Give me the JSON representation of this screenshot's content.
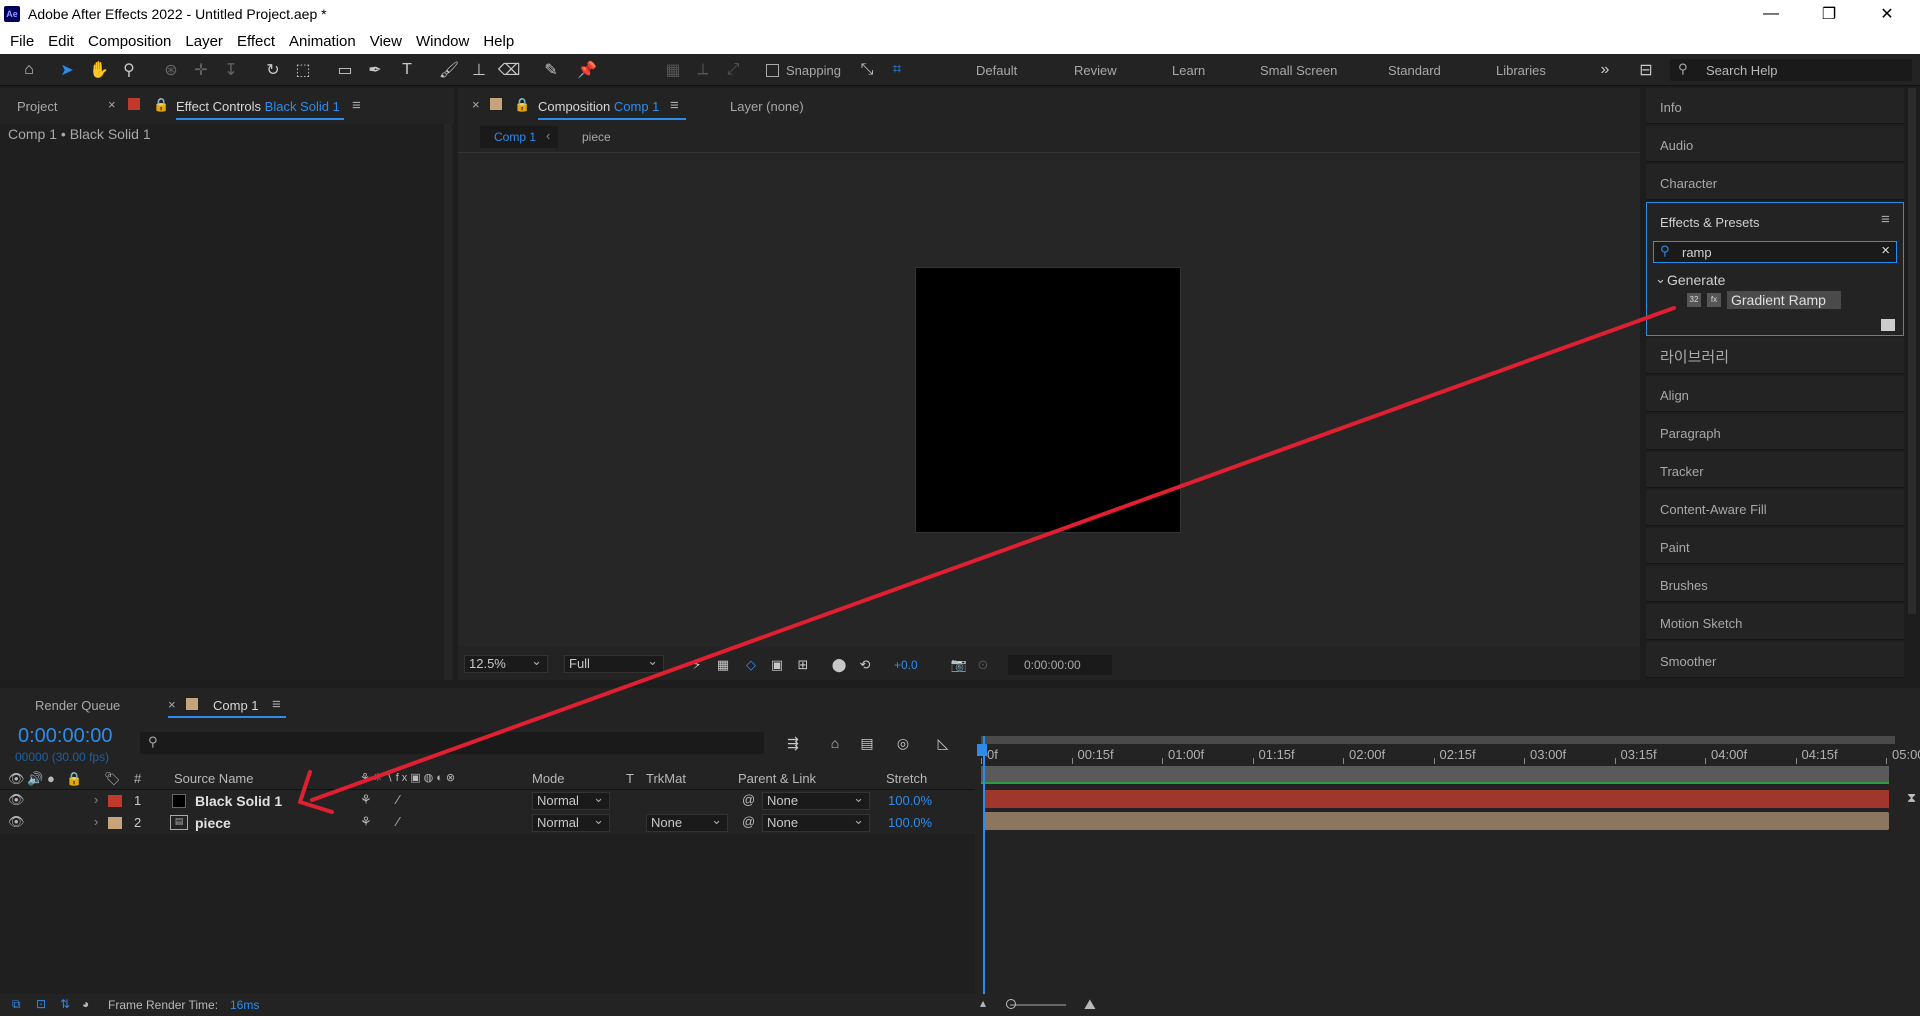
{
  "window": {
    "app_icon": "Ae",
    "title": "Adobe After Effects 2022 - Untitled Project.aep *",
    "controls": [
      "minimize-icon",
      "restore-icon",
      "close-icon"
    ]
  },
  "menu": [
    "File",
    "Edit",
    "Composition",
    "Layer",
    "Effect",
    "Animation",
    "View",
    "Window",
    "Help"
  ],
  "toolbar": {
    "snapping_label": "Snapping",
    "workspaces": [
      "Default",
      "Review",
      "Learn",
      "Small Screen",
      "Standard",
      "Libraries"
    ],
    "search_placeholder": "Search Help"
  },
  "left_panel": {
    "tab_project": "Project",
    "tab_effect_controls_prefix": "Effect Controls",
    "tab_effect_controls_layer": "Black Solid 1",
    "breadcrumb": "Comp 1 • Black Solid 1"
  },
  "comp_panel": {
    "tab_prefix": "Composition",
    "tab_comp": "Comp 1",
    "layer_tab": "Layer (none)",
    "sub_tab_active": "Comp 1",
    "sub_tab_other": "piece",
    "zoom": "12.5%",
    "resolution": "Full",
    "exposure": "+0.0",
    "timecode": "0:00:00:00"
  },
  "right_panel": {
    "items_top": [
      "Info",
      "Audio",
      "Character"
    ],
    "effects_title": "Effects & Presets",
    "search_value": "ramp",
    "category": "Generate",
    "effect": "Gradient Ramp",
    "items_bottom": [
      "라이브러리",
      "Align",
      "Paragraph",
      "Tracker",
      "Content-Aware Fill",
      "Paint",
      "Brushes",
      "Motion Sketch",
      "Smoother"
    ]
  },
  "timeline": {
    "tab_render_queue": "Render Queue",
    "tab_comp": "Comp 1",
    "timecode": "0:00:00:00",
    "frames": "00000 (30.00 fps)",
    "headers": {
      "num": "#",
      "source_name": "Source Name",
      "mode": "Mode",
      "t": "T",
      "trkmat": "TrkMat",
      "parent": "Parent & Link",
      "stretch": "Stretch"
    },
    "ruler": [
      "0f",
      "00:15f",
      "01:00f",
      "01:15f",
      "02:00f",
      "02:15f",
      "03:00f",
      "03:15f",
      "04:00f",
      "04:15f",
      "05:00"
    ],
    "layers": [
      {
        "num": "1",
        "name": "Black Solid 1",
        "label_color": "#c0392b",
        "mode": "Normal",
        "trkmat": "",
        "parent": "None",
        "stretch": "100.0%",
        "bar_color": "#a0372d"
      },
      {
        "num": "2",
        "name": "piece",
        "label_color": "#c8a47a",
        "mode": "Normal",
        "trkmat": "None",
        "parent": "None",
        "stretch": "100.0%",
        "bar_color": "#8c7660"
      }
    ],
    "status_label": "Frame Render Time:",
    "status_value": "16ms"
  }
}
